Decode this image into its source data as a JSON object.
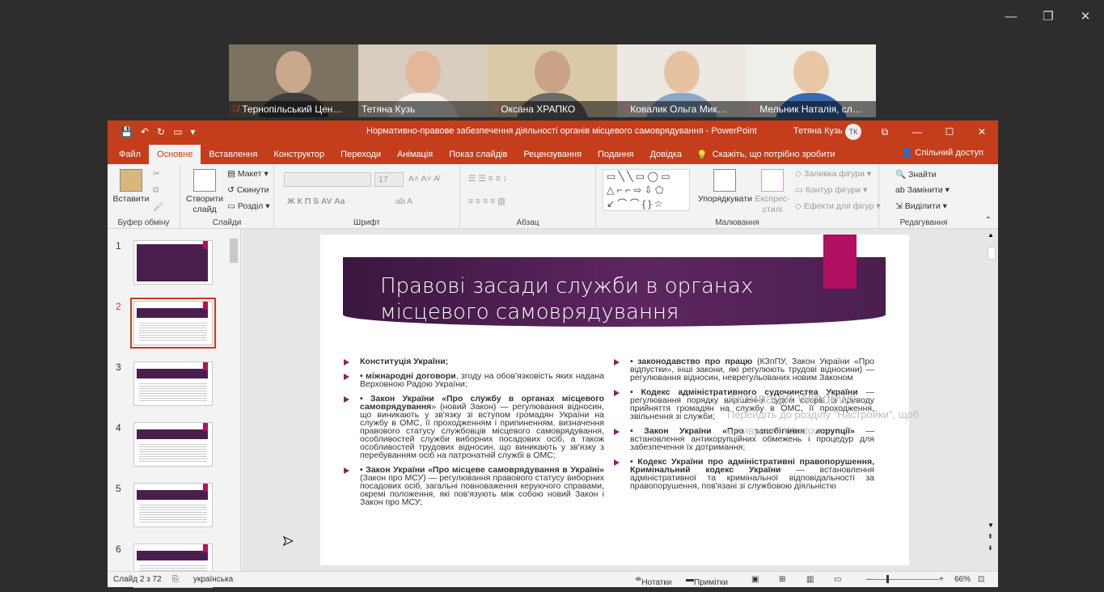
{
  "window_controls": {
    "minimize": "—",
    "restore": "❐",
    "close": "✕"
  },
  "participants": [
    {
      "name": "Тернопільський Цен…",
      "muted": true,
      "bg": "#7c7260",
      "skin": "#c9a98c",
      "cloth": "#3d3d3d"
    },
    {
      "name": "Тетяна Кузь",
      "muted": false,
      "bg": "#d8cdbf",
      "skin": "#e2b79a",
      "cloth": "#f2eee9"
    },
    {
      "name": "Оксана ХРАПКО",
      "muted": true,
      "bg": "#d9c9a6",
      "skin": "#caa285",
      "cloth": "#6a6a6a"
    },
    {
      "name": "Ковалик Ольга Мик…",
      "muted": true,
      "bg": "#ece8e2",
      "skin": "#e6c2a3",
      "cloth": "#8aa8c6"
    },
    {
      "name": "Мельник Наталія, сл…",
      "muted": true,
      "bg": "#f0eee9",
      "skin": "#e8c7a6",
      "cloth": "#3a6ab1"
    }
  ],
  "titlebar": {
    "qat": [
      "💾",
      "↶",
      "↻",
      "▭",
      "▾"
    ],
    "title": "Нормативно-правове забезпечення діяльності органів місцевого самоврядування  -  PowerPoint",
    "user": "Тетяна Кузь",
    "avatar": "ТК",
    "controls": [
      "⧉",
      "—",
      "☐",
      "✕"
    ]
  },
  "tabs": [
    "Файл",
    "Основне",
    "Вставлення",
    "Конструктор",
    "Переходи",
    "Анімація",
    "Показ слайдів",
    "Рецензування",
    "Подання",
    "Довідка"
  ],
  "tell_me": "Скажіть, що потрібно зробити",
  "share": "Спільний доступ",
  "ribbon": {
    "clipboard": {
      "paste": "Вставити",
      "label": "Буфер обміну"
    },
    "slides": {
      "new_slide": "Створити слайд",
      "layout": "Макет",
      "reset": "Скинути",
      "section": "Розділ",
      "label": "Слайди"
    },
    "font": {
      "size": "17",
      "label": "Шрифт"
    },
    "paragraph": {
      "label": "Абзац"
    },
    "drawing": {
      "arrange": "Упорядкувати",
      "styles": "Експрес-стилі",
      "fill": "Заливка фігури",
      "outline": "Контур фігури",
      "effects": "Ефекти для фігур",
      "label": "Малювання"
    },
    "editing": {
      "find": "Знайти",
      "replace": "Замінити",
      "select": "Виділити",
      "label": "Редагування"
    }
  },
  "thumbnails": [
    {
      "num": "1",
      "selected": false
    },
    {
      "num": "2",
      "selected": true
    },
    {
      "num": "3",
      "selected": false
    },
    {
      "num": "4",
      "selected": false
    },
    {
      "num": "5",
      "selected": false
    },
    {
      "num": "6",
      "selected": false
    }
  ],
  "slide": {
    "title": "Правові засади служби в органах місцевого самоврядування",
    "left": [
      {
        "bold": "Конституція України;",
        "text": ""
      },
      {
        "bold": "• міжнародні договори",
        "text": ", згоду на обов'язковість яких надана Верховною Радою України;"
      },
      {
        "bold": "• Закон України «Про службу в органах місцевого самоврядування",
        "text": "» (новий Закон) — регулювання відносин, що виникають у зв'язку зі вступом громадян України на службу в ОМС, її проходженням і припиненням, визначення правового статусу службовців місцевого самоврядування, особливостей служби виборних посадових осіб, а також особливостей трудових відносин, що виникають у зв'язку з перебуванням осіб на патронатній службі в ОМС;"
      },
      {
        "bold": "• Закон України «Про місцеве самоврядування в Україні»",
        "text": " (Закон про МСУ) — регулювання правового статусу виборних посадових осіб, загальні повноваження керуючого справами, окремі положення, які пов'язують між собою новий Закон і Закон про МСУ;"
      }
    ],
    "right": [
      {
        "bold": "• законодавство про працю",
        "text": " (КЗпПУ, Закон України «Про відпустки», інші закони, які регулюють трудові відносини) — регулювання відносин, неврегульованих новим Законом"
      },
      {
        "bold": "• Кодекс адміністративного судочинства України",
        "text": " — регулювання порядку вирішення судом спорів із приводу прийняття громадян на службу в ОМС, її проходження, звільнення зі служби;"
      },
      {
        "bold": "• Закон України «Про запобігання корупції»",
        "text": " — встановлення антикорупційних обмежень і процедур для забезпечення їх дотримання;"
      },
      {
        "bold": "• Кодекс України про адміністративні правопорушення, Кримінальний кодекс України",
        "text": " — встановлення адміністративної та кримінальної відповідальності за правопорушення, пов'язані зі службовою діяльністю"
      }
    ]
  },
  "activation": {
    "title": "Активація Windows",
    "line1": "Перейдіть до розділу \"Настройки\", щоб",
    "line2": "активувати Windows."
  },
  "status": {
    "slide": "Слайд 2 з 72",
    "lang": "українська",
    "notes": "Нотатки",
    "comments": "Примітки",
    "zoom": "66%"
  }
}
